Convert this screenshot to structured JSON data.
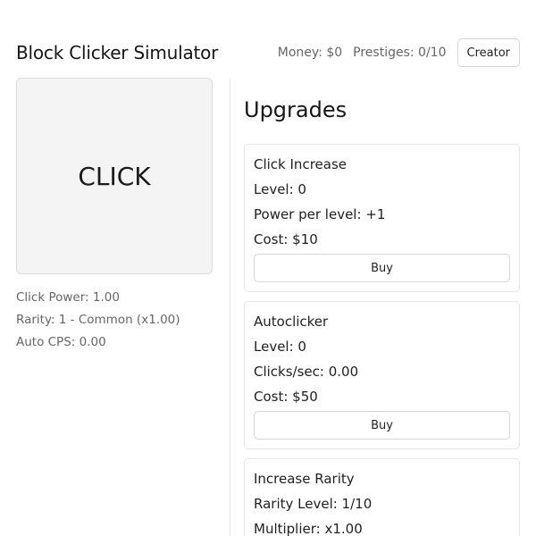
{
  "header": {
    "title": "Block Clicker Simulator",
    "money": "Money: $0",
    "prestiges": "Prestiges: 0/10",
    "creator_label": "Creator"
  },
  "clicker": {
    "label": "CLICK",
    "stats": {
      "click_power": "Click Power: 1.00",
      "rarity": "Rarity: 1 - Common (x1.00)",
      "auto_cps": "Auto CPS: 0.00"
    }
  },
  "upgrades": {
    "title": "Upgrades",
    "items": [
      {
        "name": "Click Increase",
        "level": "Level: 0",
        "detail": "Power per level: +1",
        "cost": "Cost: $10",
        "buy_label": "Buy"
      },
      {
        "name": "Autoclicker",
        "level": "Level: 0",
        "detail": "Clicks/sec: 0.00",
        "cost": "Cost: $50",
        "buy_label": "Buy"
      },
      {
        "name": "Increase Rarity",
        "level": "Rarity Level: 1/10",
        "detail": "Multiplier: x1.00"
      }
    ]
  }
}
